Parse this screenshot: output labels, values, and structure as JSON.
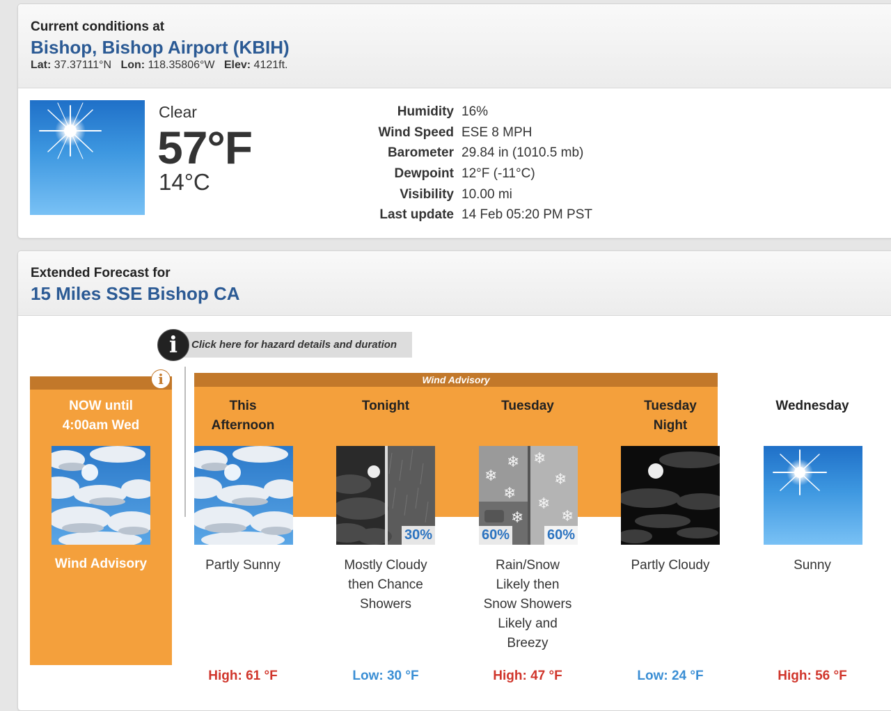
{
  "current": {
    "header_label": "Current conditions at",
    "station": "Bishop, Bishop Airport (KBIH)",
    "lat_label": "Lat:",
    "lat": "37.37111°N",
    "lon_label": "Lon:",
    "lon": "118.35806°W",
    "elev_label": "Elev:",
    "elev": "4121ft.",
    "condition": "Clear",
    "temp_f": "57°F",
    "temp_c": "14°C",
    "icon": "sunny-icon",
    "details": [
      {
        "label": "Humidity",
        "value": "16%"
      },
      {
        "label": "Wind Speed",
        "value": "ESE 8 MPH"
      },
      {
        "label": "Barometer",
        "value": "29.84 in (1010.5 mb)"
      },
      {
        "label": "Dewpoint",
        "value": "12°F (-11°C)"
      },
      {
        "label": "Visibility",
        "value": "10.00 mi"
      },
      {
        "label": "Last update",
        "value": "14 Feb 05:20 PM PST"
      }
    ]
  },
  "forecast": {
    "header_label": "Extended Forecast for",
    "location": "15 Miles SSE Bishop CA",
    "hazard_link": "Click here for hazard details and duration",
    "hazard_icon": "info-icon",
    "now": {
      "label_line1": "NOW until",
      "label_line2": "4:00am Wed",
      "advisory": "Wind Advisory"
    },
    "advisory_band": "Wind Advisory",
    "periods": [
      {
        "name_line1": "This",
        "name_line2": "Afternoon",
        "desc": [
          "Partly Sunny"
        ],
        "temp": "High: 61 °F",
        "temp_kind": "high",
        "icon": "partly-sunny-icon"
      },
      {
        "name_line1": "Tonight",
        "name_line2": "",
        "desc": [
          "Mostly Cloudy",
          "then Chance",
          "Showers"
        ],
        "temp": "Low: 30 °F",
        "temp_kind": "low",
        "icon": "cloudy-showers-icon",
        "pct_right": "30%"
      },
      {
        "name_line1": "Tuesday",
        "name_line2": "",
        "desc": [
          "Rain/Snow",
          "Likely then",
          "Snow Showers",
          "Likely and",
          "Breezy"
        ],
        "temp": "High: 47 °F",
        "temp_kind": "high",
        "icon": "rain-snow-icon",
        "pct_left": "60%",
        "pct_right": "60%"
      },
      {
        "name_line1": "Tuesday",
        "name_line2": "Night",
        "desc": [
          "Partly Cloudy"
        ],
        "temp": "Low: 24 °F",
        "temp_kind": "low",
        "icon": "partly-cloudy-night-icon"
      },
      {
        "name_line1": "Wednesday",
        "name_line2": "",
        "desc": [
          "Sunny"
        ],
        "temp": "High: 56 °F",
        "temp_kind": "high",
        "icon": "sunny-icon"
      }
    ]
  }
}
